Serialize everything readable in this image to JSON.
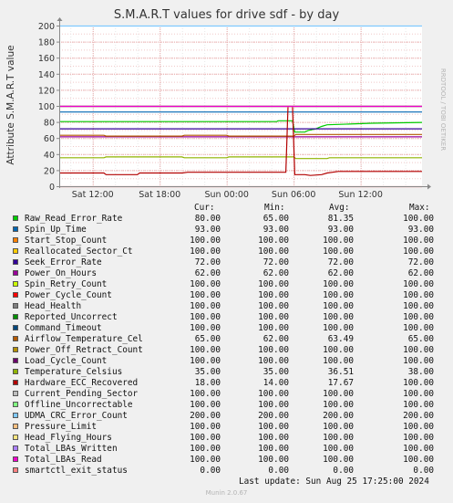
{
  "chart_data": {
    "type": "line",
    "title": "S.M.A.R.T values for drive sdf - by day",
    "ylabel": "Attribute S.M.A.R.T value",
    "xlabel": "",
    "ylim": [
      0,
      200
    ],
    "y_ticks": [
      "0",
      "20",
      "40",
      "60",
      "80",
      "100",
      "120",
      "140",
      "160",
      "180",
      "200"
    ],
    "x_ticks": [
      {
        "label": "Sat 12:00",
        "h": 12
      },
      {
        "label": "Sat 18:00",
        "h": 18
      },
      {
        "label": "Sun 00:00",
        "h": 24
      },
      {
        "label": "Sun 06:00",
        "h": 30
      },
      {
        "label": "Sun 12:00",
        "h": 36
      }
    ],
    "x_hours_range": [
      9,
      41.5
    ],
    "grid": true,
    "series": [
      {
        "name": "Raw_Read_Error_Rate",
        "color": "#00cc00",
        "points": [
          [
            9,
            81
          ],
          [
            28.5,
            81
          ],
          [
            28.6,
            82
          ],
          [
            29.9,
            82
          ],
          [
            30.1,
            68
          ],
          [
            31,
            68
          ],
          [
            31.3,
            70
          ],
          [
            32,
            72
          ],
          [
            32.5,
            75
          ],
          [
            33,
            77
          ],
          [
            35,
            78
          ],
          [
            37,
            79
          ],
          [
            41.5,
            80
          ]
        ]
      },
      {
        "name": "Spin_Up_Time",
        "color": "#0066b3",
        "points": [
          [
            9,
            93
          ],
          [
            41.5,
            93
          ]
        ]
      },
      {
        "name": "Start_Stop_Count",
        "color": "#ff8000",
        "points": [
          [
            9,
            100
          ],
          [
            41.5,
            100
          ]
        ]
      },
      {
        "name": "Reallocated_Sector_Ct",
        "color": "#ffcc00",
        "points": [
          [
            9,
            100
          ],
          [
            41.5,
            100
          ]
        ]
      },
      {
        "name": "Seek_Error_Rate",
        "color": "#330099",
        "points": [
          [
            9,
            72
          ],
          [
            41.5,
            72
          ]
        ]
      },
      {
        "name": "Power_On_Hours",
        "color": "#990099",
        "points": [
          [
            9,
            62
          ],
          [
            41.5,
            62
          ]
        ]
      },
      {
        "name": "Spin_Retry_Count",
        "color": "#ccff00",
        "points": [
          [
            9,
            100
          ],
          [
            41.5,
            100
          ]
        ]
      },
      {
        "name": "Power_Cycle_Count",
        "color": "#ff0000",
        "points": [
          [
            9,
            100
          ],
          [
            41.5,
            100
          ]
        ]
      },
      {
        "name": "Head_Health",
        "color": "#808080",
        "points": [
          [
            9,
            100
          ],
          [
            41.5,
            100
          ]
        ]
      },
      {
        "name": "Reported_Uncorrect",
        "color": "#008f00",
        "points": [
          [
            9,
            100
          ],
          [
            41.5,
            100
          ]
        ]
      },
      {
        "name": "Command_Timeout",
        "color": "#00487d",
        "points": [
          [
            9,
            100
          ],
          [
            41.5,
            100
          ]
        ]
      },
      {
        "name": "Airflow_Temperature_Cel",
        "color": "#b35a00",
        "points": [
          [
            9,
            64
          ],
          [
            13,
            64
          ],
          [
            13.2,
            63
          ],
          [
            20,
            63
          ],
          [
            20.2,
            64
          ],
          [
            24,
            64
          ],
          [
            24.2,
            63
          ],
          [
            30,
            63
          ],
          [
            30.2,
            65
          ],
          [
            41.5,
            65
          ]
        ]
      },
      {
        "name": "Power_Off_Retract_Count",
        "color": "#b38f00",
        "points": [
          [
            9,
            100
          ],
          [
            41.5,
            100
          ]
        ]
      },
      {
        "name": "Load_Cycle_Count",
        "color": "#6b006b",
        "points": [
          [
            9,
            100
          ],
          [
            41.5,
            100
          ]
        ]
      },
      {
        "name": "Temperature_Celsius",
        "color": "#8fb300",
        "points": [
          [
            9,
            36
          ],
          [
            13,
            36
          ],
          [
            13.2,
            37
          ],
          [
            20,
            37
          ],
          [
            20.2,
            36
          ],
          [
            24,
            36
          ],
          [
            24.2,
            37
          ],
          [
            30,
            37
          ],
          [
            30.2,
            35
          ],
          [
            33,
            35
          ],
          [
            33.2,
            36
          ],
          [
            41.5,
            36
          ]
        ]
      },
      {
        "name": "Hardware_ECC_Recovered",
        "color": "#b30000",
        "points": [
          [
            9,
            17
          ],
          [
            13,
            17
          ],
          [
            13.2,
            15
          ],
          [
            16,
            15
          ],
          [
            16.2,
            17
          ],
          [
            20,
            17
          ],
          [
            20.5,
            18
          ],
          [
            29.3,
            18
          ],
          [
            29.5,
            100
          ],
          [
            29.9,
            100
          ],
          [
            30.1,
            15
          ],
          [
            31,
            15
          ],
          [
            31.5,
            14
          ],
          [
            32.5,
            15
          ],
          [
            33,
            17
          ],
          [
            33.5,
            18
          ],
          [
            34,
            19
          ],
          [
            41.5,
            19
          ]
        ]
      },
      {
        "name": "Current_Pending_Sector",
        "color": "#bebebe",
        "points": [
          [
            9,
            100
          ],
          [
            41.5,
            100
          ]
        ]
      },
      {
        "name": "Offline_Uncorrectable",
        "color": "#80ff80",
        "points": [
          [
            9,
            100
          ],
          [
            41.5,
            100
          ]
        ]
      },
      {
        "name": "UDMA_CRC_Error_Count",
        "color": "#80c9ff",
        "points": [
          [
            9,
            200
          ],
          [
            41.5,
            200
          ]
        ]
      },
      {
        "name": "Pressure_Limit",
        "color": "#ffc080",
        "points": [
          [
            9,
            100
          ],
          [
            41.5,
            100
          ]
        ]
      },
      {
        "name": "Head_Flying_Hours",
        "color": "#ffe680",
        "points": [
          [
            9,
            100
          ],
          [
            41.5,
            100
          ]
        ]
      },
      {
        "name": "Total_LBAs_Written",
        "color": "#aa80ff",
        "points": [
          [
            9,
            100
          ],
          [
            41.5,
            100
          ]
        ]
      },
      {
        "name": "Total_LBAs_Read",
        "color": "#ee00cc",
        "points": [
          [
            9,
            100
          ],
          [
            41.5,
            100
          ]
        ]
      },
      {
        "name": "smartctl_exit_status",
        "color": "#ff8080",
        "points": [
          [
            9,
            0
          ],
          [
            41.5,
            0
          ]
        ]
      }
    ]
  },
  "legend": {
    "header": {
      "cur": "Cur:",
      "min": "Min:",
      "avg": "Avg:",
      "max": "Max:"
    },
    "rows": [
      {
        "name": "Raw_Read_Error_Rate",
        "color": "#00cc00",
        "cur": "80.00",
        "min": "65.00",
        "avg": "81.35",
        "max": "100.00"
      },
      {
        "name": "Spin_Up_Time",
        "color": "#0066b3",
        "cur": "93.00",
        "min": "93.00",
        "avg": "93.00",
        "max": "93.00"
      },
      {
        "name": "Start_Stop_Count",
        "color": "#ff8000",
        "cur": "100.00",
        "min": "100.00",
        "avg": "100.00",
        "max": "100.00"
      },
      {
        "name": "Reallocated_Sector_Ct",
        "color": "#ffcc00",
        "cur": "100.00",
        "min": "100.00",
        "avg": "100.00",
        "max": "100.00"
      },
      {
        "name": "Seek_Error_Rate",
        "color": "#330099",
        "cur": "72.00",
        "min": "72.00",
        "avg": "72.00",
        "max": "72.00"
      },
      {
        "name": "Power_On_Hours",
        "color": "#990099",
        "cur": "62.00",
        "min": "62.00",
        "avg": "62.00",
        "max": "62.00"
      },
      {
        "name": "Spin_Retry_Count",
        "color": "#ccff00",
        "cur": "100.00",
        "min": "100.00",
        "avg": "100.00",
        "max": "100.00"
      },
      {
        "name": "Power_Cycle_Count",
        "color": "#ff0000",
        "cur": "100.00",
        "min": "100.00",
        "avg": "100.00",
        "max": "100.00"
      },
      {
        "name": "Head_Health",
        "color": "#808080",
        "cur": "100.00",
        "min": "100.00",
        "avg": "100.00",
        "max": "100.00"
      },
      {
        "name": "Reported_Uncorrect",
        "color": "#008f00",
        "cur": "100.00",
        "min": "100.00",
        "avg": "100.00",
        "max": "100.00"
      },
      {
        "name": "Command_Timeout",
        "color": "#00487d",
        "cur": "100.00",
        "min": "100.00",
        "avg": "100.00",
        "max": "100.00"
      },
      {
        "name": "Airflow_Temperature_Cel",
        "color": "#b35a00",
        "cur": "65.00",
        "min": "62.00",
        "avg": "63.49",
        "max": "65.00"
      },
      {
        "name": "Power_Off_Retract_Count",
        "color": "#b38f00",
        "cur": "100.00",
        "min": "100.00",
        "avg": "100.00",
        "max": "100.00"
      },
      {
        "name": "Load_Cycle_Count",
        "color": "#6b006b",
        "cur": "100.00",
        "min": "100.00",
        "avg": "100.00",
        "max": "100.00"
      },
      {
        "name": "Temperature_Celsius",
        "color": "#8fb300",
        "cur": "35.00",
        "min": "35.00",
        "avg": "36.51",
        "max": "38.00"
      },
      {
        "name": "Hardware_ECC_Recovered",
        "color": "#b30000",
        "cur": "18.00",
        "min": "14.00",
        "avg": "17.67",
        "max": "100.00"
      },
      {
        "name": "Current_Pending_Sector",
        "color": "#bebebe",
        "cur": "100.00",
        "min": "100.00",
        "avg": "100.00",
        "max": "100.00"
      },
      {
        "name": "Offline_Uncorrectable",
        "color": "#80ff80",
        "cur": "100.00",
        "min": "100.00",
        "avg": "100.00",
        "max": "100.00"
      },
      {
        "name": "UDMA_CRC_Error_Count",
        "color": "#80c9ff",
        "cur": "200.00",
        "min": "200.00",
        "avg": "200.00",
        "max": "200.00"
      },
      {
        "name": "Pressure_Limit",
        "color": "#ffc080",
        "cur": "100.00",
        "min": "100.00",
        "avg": "100.00",
        "max": "100.00"
      },
      {
        "name": "Head_Flying_Hours",
        "color": "#ffe680",
        "cur": "100.00",
        "min": "100.00",
        "avg": "100.00",
        "max": "100.00"
      },
      {
        "name": "Total_LBAs_Written",
        "color": "#aa80ff",
        "cur": "100.00",
        "min": "100.00",
        "avg": "100.00",
        "max": "100.00"
      },
      {
        "name": "Total_LBAs_Read",
        "color": "#ee00cc",
        "cur": "100.00",
        "min": "100.00",
        "avg": "100.00",
        "max": "100.00"
      },
      {
        "name": "smartctl_exit_status",
        "color": "#ff8080",
        "cur": "0.00",
        "min": "0.00",
        "avg": "0.00",
        "max": "0.00"
      }
    ]
  },
  "footer": {
    "last_update": "Last update: Sun Aug 25 17:25:00 2024",
    "version": "Munin 2.0.67"
  },
  "watermark": "RRDTOOL / TOBI OETIKER"
}
